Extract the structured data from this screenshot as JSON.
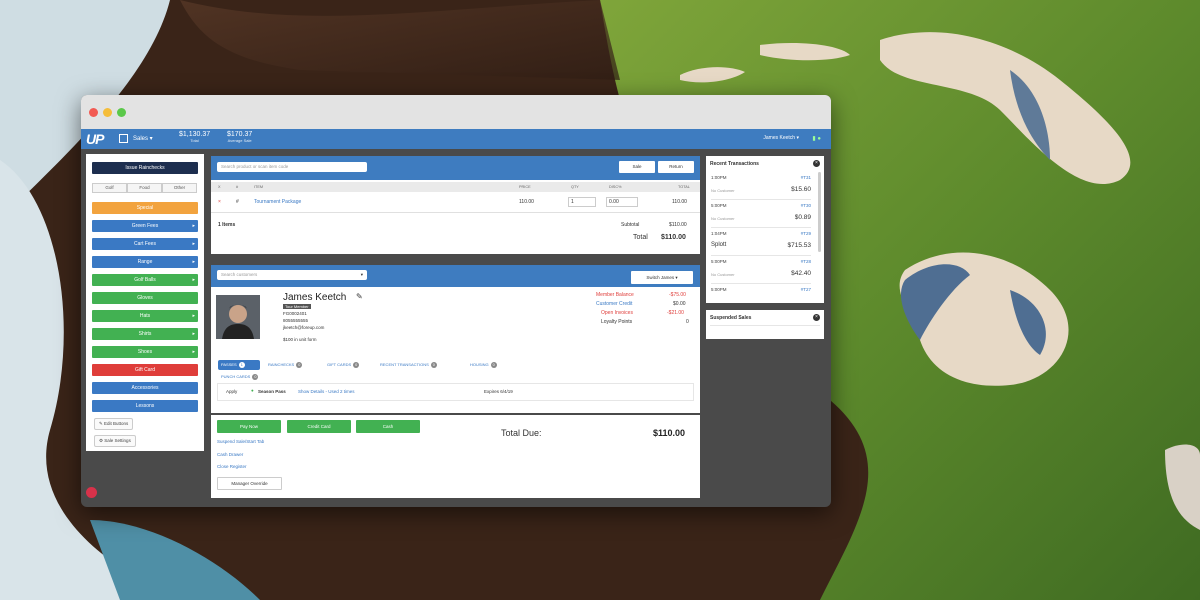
{
  "topbar": {
    "logo": "UP",
    "menu_label": "Sales ▾",
    "stats": [
      {
        "value": "$1,130.37",
        "label": "Total"
      },
      {
        "value": "$170.37",
        "label": "Average Sale"
      }
    ],
    "user": "James Keetch ▾"
  },
  "left_panel": {
    "issue_button": "Issue Rainchecks",
    "segments": [
      "Golf",
      "Food",
      "Other"
    ],
    "buttons": [
      {
        "label": "Special",
        "color": "orange",
        "arrow": false
      },
      {
        "label": "Green Fees",
        "color": "blue",
        "arrow": true
      },
      {
        "label": "Cart Fees",
        "color": "blue",
        "arrow": true
      },
      {
        "label": "Range",
        "color": "blue",
        "arrow": true
      },
      {
        "label": "Golf Balls",
        "color": "green",
        "arrow": true
      },
      {
        "label": "Gloves",
        "color": "green",
        "arrow": false
      },
      {
        "label": "Hats",
        "color": "green",
        "arrow": true
      },
      {
        "label": "Shirts",
        "color": "green",
        "arrow": true
      },
      {
        "label": "Shoes",
        "color": "green",
        "arrow": true
      },
      {
        "label": "Gift Card",
        "color": "red",
        "arrow": false
      },
      {
        "label": "Accessories",
        "color": "blue",
        "arrow": false
      },
      {
        "label": "Lessons",
        "color": "blue",
        "arrow": false
      }
    ],
    "edit_buttons": "Edit Buttons",
    "sale_settings": "Sale Settings"
  },
  "cart": {
    "search_placeholder": "Search product or scan item code",
    "sale_button": "Sale",
    "return_button": "Return",
    "headers": [
      "X",
      "#",
      "ITEM",
      "PRICE",
      "QTY",
      "DISC%",
      "TOTAL"
    ],
    "row": {
      "x": "×",
      "num": "#",
      "item": "Tournament Package",
      "price": "110.00",
      "qty": "1",
      "disc": "0.00",
      "total": "110.00"
    },
    "items_count": "1 Items",
    "subtotal_label": "Subtotal",
    "subtotal": "$110.00",
    "total_label": "Total",
    "total": "$110.00"
  },
  "customer": {
    "search_placeholder": "Search customers",
    "switch_button": "Switch James ▾",
    "name": "James Keetch",
    "tag": "Tour Member",
    "number": "FG0002401",
    "phone": "8055555555",
    "email": "jkeetch@foreup.com",
    "note": "$100 in unit form",
    "balances": [
      {
        "label": "Member Balance",
        "value": "-$75.00",
        "red": true
      },
      {
        "label": "Customer Credit",
        "value": "$0.00",
        "red": false
      },
      {
        "label": "Open Invoices",
        "value": "-$21.00",
        "red": true
      },
      {
        "label": "Loyalty Points",
        "value": "0",
        "red": false
      }
    ],
    "tabs": [
      {
        "label": "PASSES",
        "count": "1"
      },
      {
        "label": "RAINCHECKS",
        "count": "0"
      },
      {
        "label": "GIFT CARDS",
        "count": "0"
      },
      {
        "label": "RECENT TRANSACTIONS",
        "count": "0"
      },
      {
        "label": "HOUSING",
        "count": "0"
      },
      {
        "label": "PUNCH CARDS",
        "count": "0"
      }
    ],
    "pass": {
      "apply": "Apply",
      "name": "Season Pass",
      "details": "Show Details - Used 2 times",
      "expires": "Expires 6/4/19"
    }
  },
  "payment": {
    "buttons": [
      "Pay Now",
      "Credit Card",
      "Cash"
    ],
    "links": [
      "Suspend Sale/Start Tab",
      "Cash Drawer",
      "Close Register"
    ],
    "manager_override": "Manager Override",
    "total_due_label": "Total Due:",
    "total_due": "$110.00"
  },
  "recent_transactions": {
    "title": "Recent Transactions",
    "items": [
      {
        "time": "1:00PM",
        "num": "#T31",
        "customer": "No Customer",
        "amount": "$15.60"
      },
      {
        "time": "5:00PM",
        "num": "#T30",
        "customer": "No Customer",
        "amount": "$0.89"
      },
      {
        "time": "1:04PM",
        "num": "#T29",
        "customer": "Splott",
        "amount": "$715.53"
      },
      {
        "time": "5:00PM",
        "num": "#T28",
        "customer": "No Customer",
        "amount": "$42.40"
      },
      {
        "time": "5:00PM",
        "num": "#T27",
        "customer": "",
        "amount": ""
      }
    ]
  },
  "suspended_sales": {
    "title": "Suspended Sales"
  },
  "colors": {
    "brand_blue": "#3e7cc0",
    "navy": "#1d2e4f",
    "green": "#42b152",
    "orange": "#f2a33e",
    "red": "#df3d3a"
  }
}
